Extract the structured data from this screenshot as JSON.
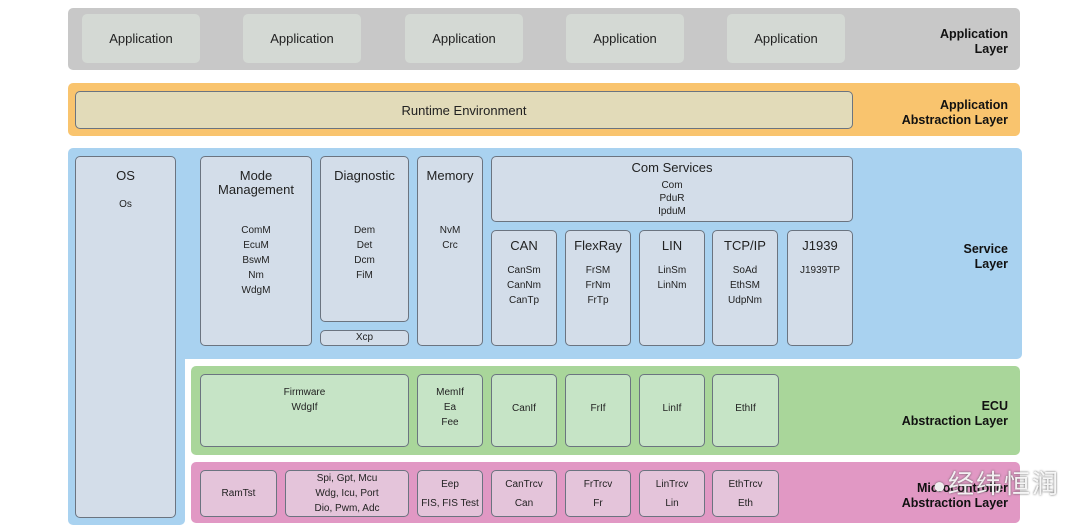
{
  "application_layer": {
    "label": "Application\nLayer",
    "apps": [
      "Application",
      "Application",
      "Application",
      "Application",
      "Application"
    ]
  },
  "app_abstraction_layer": {
    "label": "Application\nAbstraction Layer",
    "rte": "Runtime Environment"
  },
  "service_layer": {
    "label": "Service\nLayer",
    "os": {
      "title": "OS",
      "items": [
        "Os"
      ]
    },
    "mode": {
      "title": "Mode\nManagement",
      "items": [
        "ComM",
        "EcuM",
        "BswM",
        "Nm",
        "WdgM"
      ]
    },
    "diag": {
      "title": "Diagnostic",
      "items": [
        "Dem",
        "Det",
        "Dcm",
        "FiM"
      ]
    },
    "xcp": "Xcp",
    "memory": {
      "title": "Memory",
      "items": [
        "NvM",
        "Crc"
      ]
    },
    "com": {
      "title": "Com Services",
      "items": [
        "Com",
        "PduR",
        "IpduM"
      ]
    },
    "stacks": [
      {
        "title": "CAN",
        "items": [
          "CanSm",
          "CanNm",
          "CanTp"
        ]
      },
      {
        "title": "FlexRay",
        "items": [
          "FrSM",
          "FrNm",
          "FrTp"
        ]
      },
      {
        "title": "LIN",
        "items": [
          "LinSm",
          "LinNm"
        ]
      },
      {
        "title": "TCP/IP",
        "items": [
          "SoAd",
          "EthSM",
          "UdpNm"
        ]
      },
      {
        "title": "J1939",
        "items": [
          "J1939TP"
        ]
      }
    ]
  },
  "ecu_layer": {
    "label": "ECU\nAbstraction Layer",
    "boxes": [
      [
        "Firmware",
        "WdgIf"
      ],
      [
        "MemIf",
        "Ea",
        "Fee"
      ],
      [
        "CanIf"
      ],
      [
        "FrIf"
      ],
      [
        "LinIf"
      ],
      [
        "EthIf"
      ]
    ]
  },
  "mcal_layer": {
    "label": "Microcontroller\nAbstraction Layer",
    "boxes": [
      [
        "RamTst"
      ],
      [
        "Spi, Gpt, Mcu",
        "Wdg, Icu, Port",
        "Dio, Pwm, Adc"
      ],
      [
        "Eep",
        "FIS, FIS Test"
      ],
      [
        "CanTrcv",
        "Can"
      ],
      [
        "FrTrcv",
        "Fr"
      ],
      [
        "LinTrcv",
        "Lin"
      ],
      [
        "EthTrcv",
        "Eth"
      ]
    ]
  },
  "watermark": "经纬恒润",
  "colors": {
    "application": "#c8c8c8",
    "app_abstraction": "#f9c46e",
    "service": "#a9d2f0",
    "ecu": "#a9d69a",
    "mcal": "#e198c4"
  }
}
